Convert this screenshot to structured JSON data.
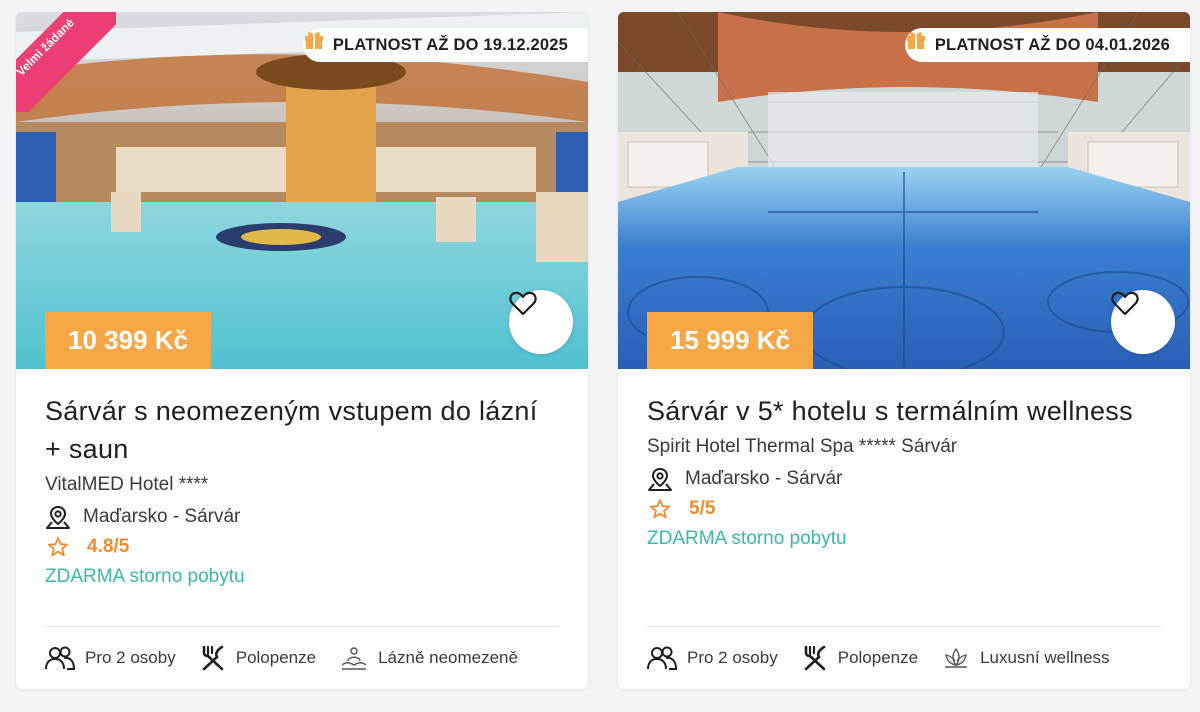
{
  "offers": [
    {
      "badge": "Velmi žádané",
      "validity": "PLATNOST AŽ DO 19.12.2025",
      "price": "10 399 Kč",
      "title": "Sárvár s neomezeným vstupem do lázní + saun",
      "hotel": "VitalMED Hotel ****",
      "location": "Maďarsko - Sárvár",
      "rating": "4.8/5",
      "storno": "ZDARMA storno pobytu",
      "features": [
        {
          "icon": "people-icon",
          "label": "Pro 2 osoby"
        },
        {
          "icon": "cutlery-icon",
          "label": "Polopenze"
        },
        {
          "icon": "spa-icon",
          "label": "Lázně neomezeně"
        }
      ]
    },
    {
      "validity": "PLATNOST AŽ DO 04.01.2026",
      "price": "15 999 Kč",
      "title": "Sárvár v 5* hotelu s termálním wellness",
      "hotel": "Spirit Hotel Thermal Spa ***** Sárvár",
      "location": "Maďarsko - Sárvár",
      "rating": "5/5",
      "storno": "ZDARMA storno pobytu",
      "features": [
        {
          "icon": "people-icon",
          "label": "Pro 2 osoby"
        },
        {
          "icon": "cutlery-icon",
          "label": "Polopenze"
        },
        {
          "icon": "lotus-icon",
          "label": "Luxusní wellness"
        }
      ]
    }
  ],
  "colors": {
    "price_bg": "#f7a745",
    "badge_bg": "#ec3f74",
    "rating": "#f08c2e",
    "storno": "#3ab8a9"
  }
}
